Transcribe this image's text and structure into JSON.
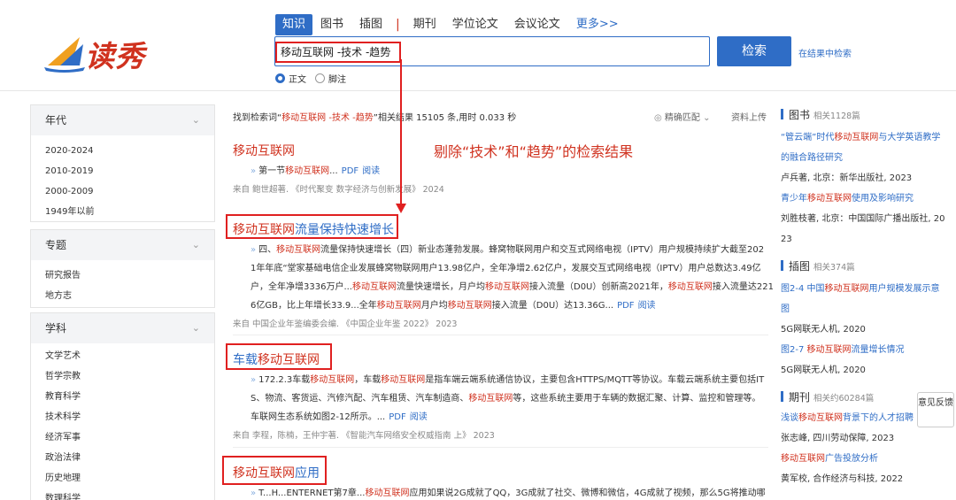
{
  "brand": {
    "logo_text": "读秀",
    "accent": "#d0321f",
    "primary": "#2f6dc6"
  },
  "tabs": [
    {
      "label": "知识",
      "active": true
    },
    {
      "label": "图书"
    },
    {
      "label": "插图"
    },
    {
      "label": "期刊"
    },
    {
      "label": "学位论文"
    },
    {
      "label": "会议论文"
    },
    {
      "label": "更多>>"
    }
  ],
  "tab_separator": "|",
  "search": {
    "value": "移动互联网 -技术 -趋势",
    "button_label": "检索",
    "in_results": "在结果中检索"
  },
  "search_mode": [
    {
      "label": "正文",
      "selected": true
    },
    {
      "label": "脚注",
      "selected": false
    }
  ],
  "sidebar": {
    "year": {
      "title": "年代",
      "items": [
        "2020-2024",
        "2010-2019",
        "2000-2009",
        "1949年以前"
      ]
    },
    "topic": {
      "title": "专题",
      "items": [
        "研究报告",
        "地方志"
      ]
    },
    "subject": {
      "title": "学科",
      "items": [
        "文学艺术",
        "哲学宗教",
        "教育科学",
        "技术科学",
        "经济军事",
        "政治法律",
        "历史地理",
        "数理科学"
      ]
    }
  },
  "summary": {
    "prefix": "找到检索词“",
    "query": "移动互联网 -技术 -趋势",
    "suffix": "”相关结果 15105 条,用时 0.033 秒",
    "match_mode": "精确匹配",
    "upload": "资料上传"
  },
  "annotation": "剔除“技术”和“趋势”的检索结果",
  "results": [
    {
      "title_red": "移动互联网",
      "title_blue": "",
      "body": [
        [
          "",
          "第一节"
        ],
        [
          "red",
          "移动互联网"
        ],
        [
          "",
          "..."
        ]
      ],
      "pdf": "PDF",
      "read": "阅读",
      "source": "来自 鲍世超著. 《时代聚变 数字经济与创新发展》 2024"
    },
    {
      "title_red": "移动互联网",
      "title_blue": "流量保持快速增长",
      "lines": [
        [
          [
            "",
            "四、"
          ],
          [
            "red",
            "移动互联网"
          ],
          [
            "",
            "流量保持快速增长（四）新业态蓬勃发展。蜂窝物联网用户和交互式网络电视（IPTV）用户规模持续扩大截至202"
          ]
        ],
        [
          [
            "",
            "1年年底“堂家基础电信企业发展蜂窝物联网用户13.98亿户，全年净增2.62亿户，发展交互式网络电视（IPTV）用户总数达3.49亿"
          ]
        ],
        [
          [
            "",
            "户，全年净增3336万户..."
          ],
          [
            "red",
            "移动互联网"
          ],
          [
            "",
            "流量快速增长，月户均"
          ],
          [
            "red",
            "移动互联网"
          ],
          [
            "",
            "接入流量（D0U）创新高2021年，"
          ],
          [
            "red",
            "移动互联网"
          ],
          [
            "",
            "接入流量达221"
          ]
        ],
        [
          [
            "",
            "6亿GB，比上年增长33.9...全年"
          ],
          [
            "red",
            "移动互联网"
          ],
          [
            "",
            "月户均"
          ],
          [
            "red",
            "移动互联网"
          ],
          [
            "",
            "接入流量（D0U）达13.36G..."
          ]
        ]
      ],
      "pdf": "PDF",
      "read": "阅读",
      "source": "来自 中国企业年鉴编委会编. 《中国企业年鉴 2022》 2023"
    },
    {
      "title_red": "车载",
      "title_mid": "移动互联网",
      "title_blue": "",
      "lines": [
        [
          [
            "",
            "172.2.3车载"
          ],
          [
            "red",
            "移动互联网"
          ],
          [
            "",
            "，车载"
          ],
          [
            "red",
            "移动互联网"
          ],
          [
            "",
            "是指车端云端系统通信协议，主要包含HTTPS/MQTT等协议。车载云端系统主要包括IT"
          ]
        ],
        [
          [
            "",
            "S、物流、客货运、汽修汽配、汽车租赁、汽车制造商、"
          ],
          [
            "red",
            "移动互联网"
          ],
          [
            "",
            "等，这些系统主要用于车辆的数据汇聚、计算、监控和管理等。"
          ]
        ],
        [
          [
            "",
            "车联网生态系统如图2-12所示。..."
          ]
        ]
      ],
      "pdf": "PDF",
      "read": "阅读",
      "source": "来自 李程，陈楠，王仲宇著. 《智能汽车网络安全权威指南 上》 2023"
    },
    {
      "title_red": "移动互联网",
      "title_blue": "应用",
      "lines": [
        [
          [
            "",
            "T...H...ENTERNET第7章..."
          ],
          [
            "red",
            "移动互联网"
          ],
          [
            "",
            "应用如果说2G成就了QQ，3G成就了社交、微博和微信，4G成就了视频，那么5G将推动哪"
          ]
        ]
      ]
    }
  ],
  "right_panel": {
    "books": {
      "title": "图书",
      "count": "相关1128篇",
      "entries": [
        {
          "link": [
            [
              "",
              "“管云端”时代"
            ],
            [
              "red",
              "移动互联网"
            ],
            [
              "",
              "与大学英语教学"
            ]
          ],
          "link2": "的融合路径研究",
          "meta": "卢兵著, 北京：新华出版社, 2023"
        },
        {
          "link": [
            [
              "",
              "青少年"
            ],
            [
              "red",
              "移动互联网"
            ],
            [
              "",
              "使用及影响研究"
            ]
          ],
          "meta": "刘胜枝著, 北京：中国国际广播出版社, 20",
          "meta2": "23"
        }
      ]
    },
    "figures": {
      "title": "插图",
      "count": "相关374篇",
      "entries": [
        {
          "link": [
            [
              "",
              "图2-4 中国"
            ],
            [
              "red",
              "移动互联网"
            ],
            [
              "",
              "用户规模发展示意"
            ]
          ],
          "link2": "图",
          "meta": "5G网联无人机, 2020"
        },
        {
          "link": [
            [
              "",
              "图2-7 "
            ],
            [
              "red",
              "移动互联网"
            ],
            [
              "",
              "流量增长情况"
            ]
          ],
          "meta": "5G网联无人机, 2020"
        }
      ]
    },
    "journals": {
      "title": "期刊",
      "count": "相关约60284篇",
      "entries": [
        {
          "link": [
            [
              "",
              "浅谈"
            ],
            [
              "red",
              "移动互联网"
            ],
            [
              "",
              "背景下的人才招聘"
            ]
          ],
          "meta": "张志峰, 四川劳动保障, 2023"
        },
        {
          "link": [
            [
              "red",
              "移动互联网"
            ],
            [
              "",
              "广告投放分析"
            ]
          ],
          "meta": "黄军校, 合作经济与科技, 2022"
        }
      ]
    },
    "feedback": "意见反馈"
  }
}
